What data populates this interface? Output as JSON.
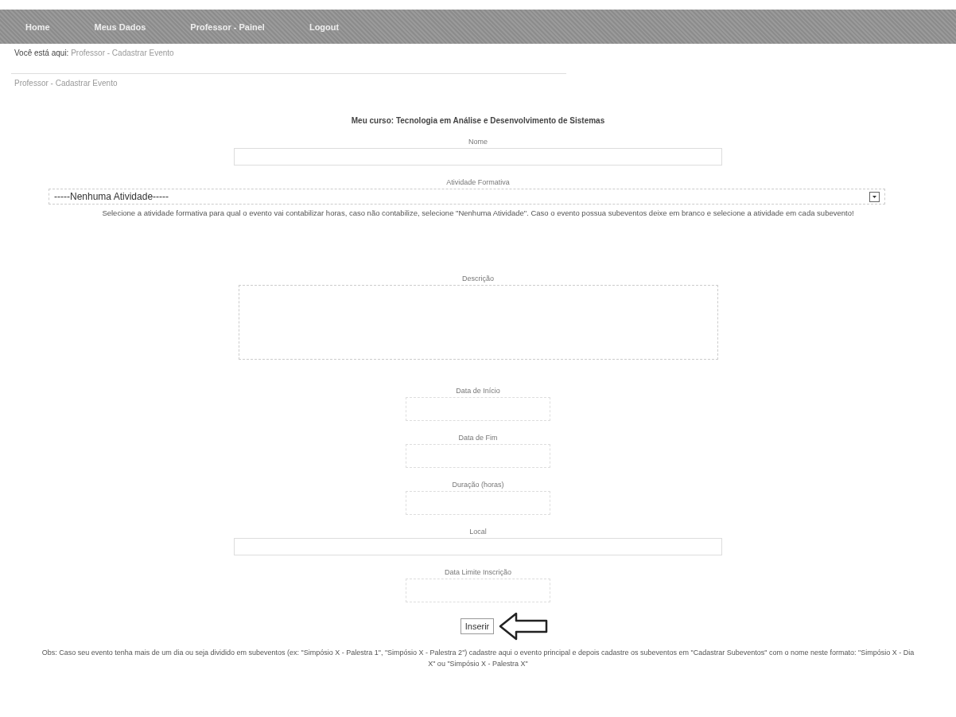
{
  "nav": {
    "items": [
      "Home",
      "Meus Dados",
      "Professor - Painel",
      "Logout"
    ]
  },
  "breadcrumb": {
    "prefix": "Você está aqui:",
    "path": "Professor - Cadastrar Evento"
  },
  "section_title": "Professor - Cadastrar Evento",
  "course": "Meu curso: Tecnologia em Análise e Desenvolvimento de Sistemas",
  "fields": [
    {
      "label": "Nome",
      "kind": "wide"
    },
    {
      "label": "Atividade Formativa",
      "kind": "select",
      "value": "-----Nenhuma Atividade-----",
      "hint": "Selecione a atividade formativa para qual o evento vai contabilizar horas, caso não contabilize, selecione \"Nenhuma Atividade\". Caso o evento possua subeventos deixe em branco e selecione a atividade em cada subevento!"
    },
    {
      "label": "Descrição",
      "kind": "textarea"
    },
    {
      "label": "Data de Início",
      "kind": "short"
    },
    {
      "label": "Data de Fim",
      "kind": "short"
    },
    {
      "label": "Duração (horas)",
      "kind": "short"
    },
    {
      "label": "Local",
      "kind": "wide"
    },
    {
      "label": "Data Limite Inscrição",
      "kind": "short"
    }
  ],
  "submit": "Inserir",
  "note": "Obs: Caso seu evento tenha mais de um dia ou seja dividido em subeventos (ex: \"Simpósio X - Palestra 1\", \"Simpósio X - Palestra 2\") cadastre aqui o evento principal e depois cadastre os subeventos em \"Cadastrar Subeventos\" com o nome neste formato: \"Simpósio X - Dia X\" ou \"Simpósio X - Palestra X\""
}
